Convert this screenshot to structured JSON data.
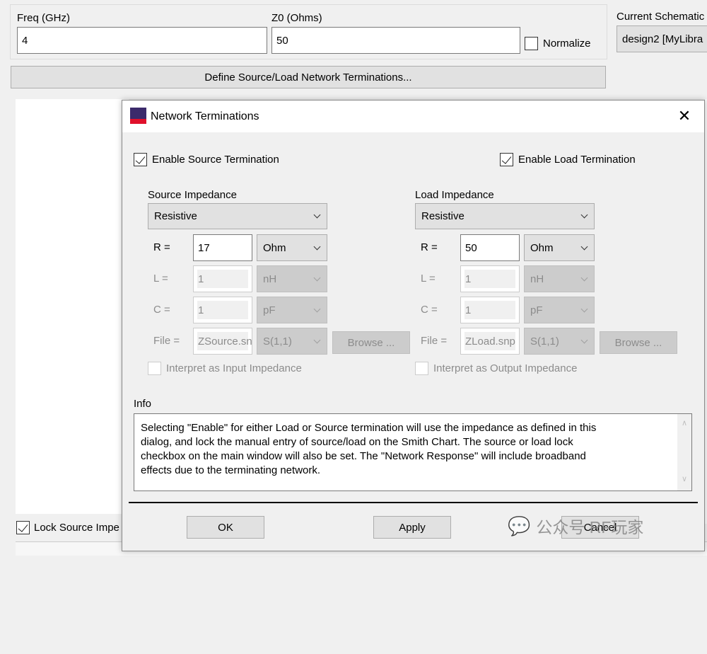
{
  "main": {
    "freq_label": "Freq (GHz)",
    "freq_value": "4",
    "z0_label": "Z0 (Ohms)",
    "z0_value": "50",
    "normalize_label": "Normalize",
    "normalize_checked": false,
    "current_schematic_label": "Current Schematic",
    "current_schematic_value": "design2 [MyLibra",
    "define_button": "Define Source/Load Network Terminations...",
    "lock_source_label": "Lock Source Impe",
    "lock_source_checked": true
  },
  "dialog": {
    "title": "Network Terminations",
    "icon": "app-logo-icon",
    "enable_source_label": "Enable Source Termination",
    "enable_source_checked": true,
    "enable_load_label": "Enable Load Termination",
    "enable_load_checked": true,
    "source": {
      "heading": "Source Impedance",
      "type": "Resistive",
      "r_label": "R =",
      "r_value": "17",
      "r_unit": "Ohm",
      "l_label": "L =",
      "l_value": "1",
      "l_unit": "nH",
      "c_label": "C =",
      "c_value": "1",
      "c_unit": "pF",
      "file_label": "File =",
      "file_value": "ZSource.snp",
      "file_param": "S(1,1)",
      "browse": "Browse ...",
      "interpret_label": "Interpret as Input Impedance",
      "interpret_checked": false
    },
    "load": {
      "heading": "Load Impedance",
      "type": "Resistive",
      "r_label": "R =",
      "r_value": "50",
      "r_unit": "Ohm",
      "l_label": "L =",
      "l_value": "1",
      "l_unit": "nH",
      "c_label": "C =",
      "c_value": "1",
      "c_unit": "pF",
      "file_label": "File =",
      "file_value": "ZLoad.snp",
      "file_param": "S(1,1)",
      "browse": "Browse ...",
      "interpret_label": "Interpret as Output Impedance",
      "interpret_checked": false
    },
    "info_label": "Info",
    "info_text": "Selecting \"Enable\" for either Load or Source termination will use the impedance as defined in this dialog, and lock the manual entry of source/load on the Smith Chart.  The source or load lock checkbox on the main window will also be set. The \"Network Response\" will include broadband effects due to the terminating network.",
    "ok": "OK",
    "apply": "Apply",
    "cancel": "Cancel"
  },
  "watermark": "公众号 RF玩家"
}
